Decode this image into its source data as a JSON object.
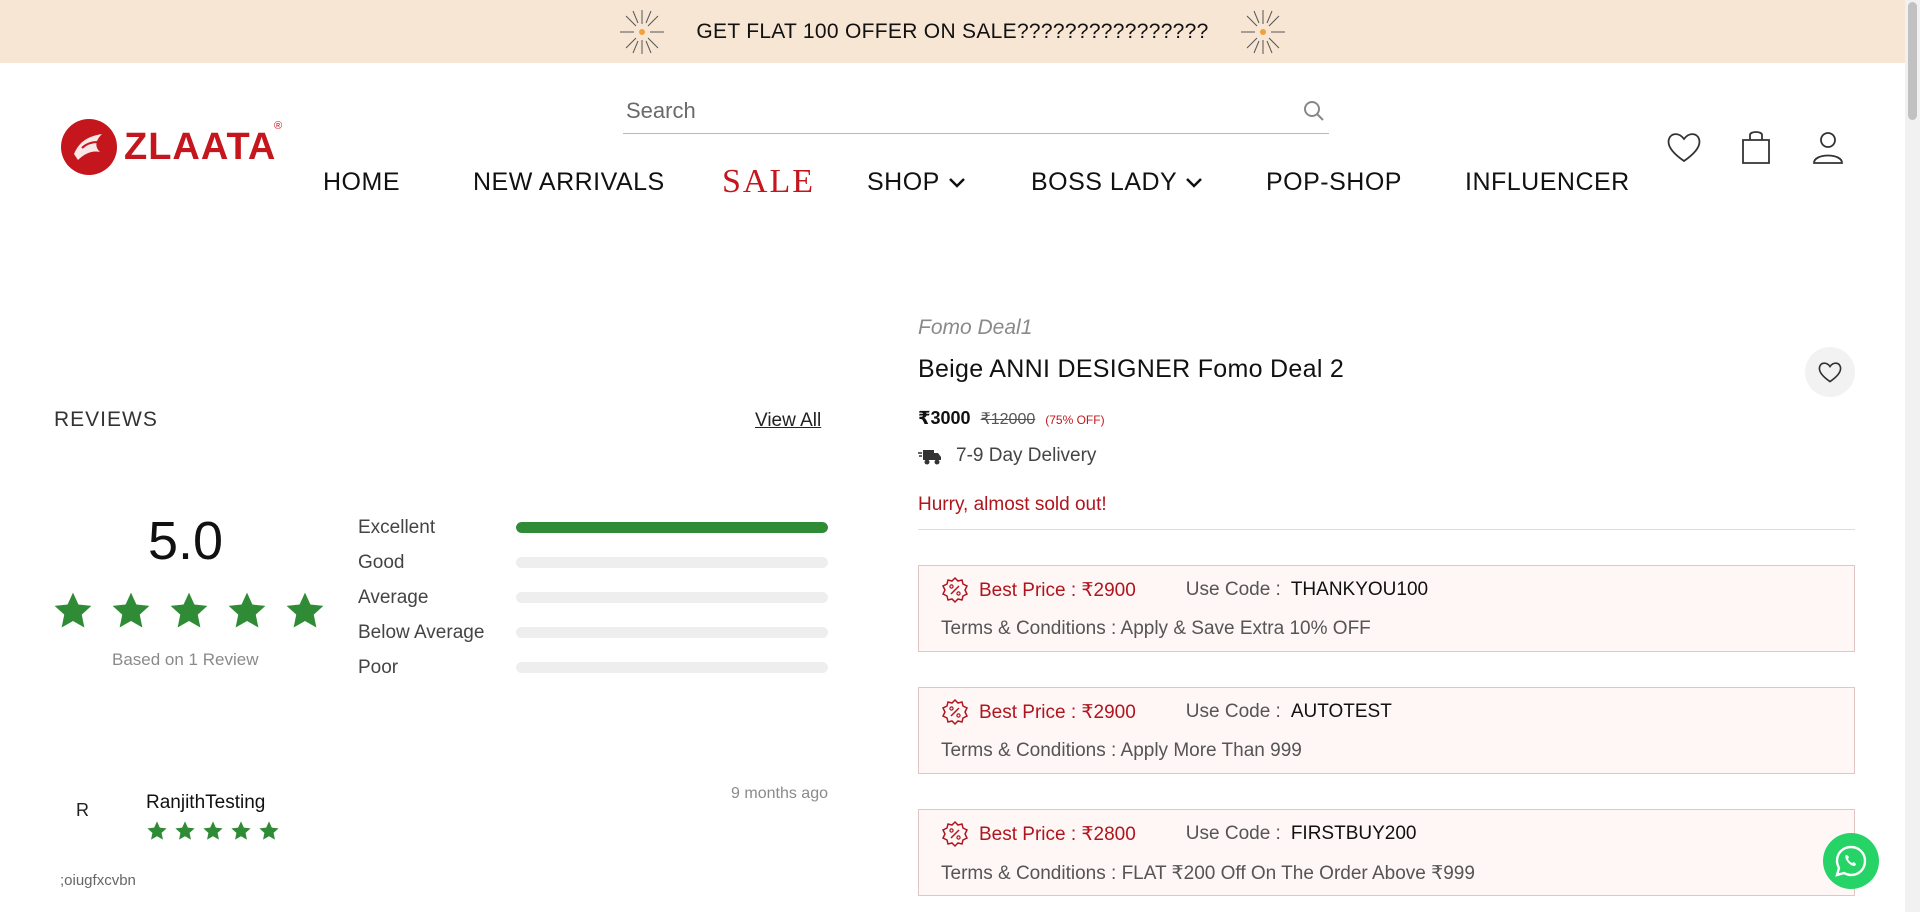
{
  "announcement": {
    "text": "GET FLAT 100 OFFER ON SALE????????????????"
  },
  "brand_logo": {
    "text": "ZLAATA",
    "registered": "®"
  },
  "search": {
    "placeholder": "Search"
  },
  "nav": {
    "items": [
      {
        "label": "HOME"
      },
      {
        "label": "NEW ARRIVALS"
      },
      {
        "label": "SALE"
      },
      {
        "label": "SHOP"
      },
      {
        "label": "BOSS LADY"
      },
      {
        "label": "POP-SHOP"
      },
      {
        "label": "INFLUENCER"
      }
    ]
  },
  "header_icons": [
    "heart-icon",
    "shopping-bag-icon",
    "user-icon"
  ],
  "reviews": {
    "title": "REVIEWS",
    "view_all": "View All",
    "score": "5.0",
    "stars": 5,
    "based_on": "Based on 1 Review",
    "breakdown": [
      {
        "label": "Excellent",
        "fraction": 1.0
      },
      {
        "label": "Good",
        "fraction": 0
      },
      {
        "label": "Average",
        "fraction": 0
      },
      {
        "label": "Below Average",
        "fraction": 0
      },
      {
        "label": "Poor",
        "fraction": 0
      }
    ],
    "items": [
      {
        "initial": "R",
        "name": "RanjithTesting",
        "stars": 5,
        "time": "9 months ago",
        "text": ";oiugfxcvbn"
      }
    ]
  },
  "product": {
    "brand": "Fomo Deal1",
    "title": "Beige ANNI DESIGNER Fomo Deal 2",
    "price": "₹3000",
    "mrp": "₹12000",
    "discount": "(75% OFF)",
    "delivery": "7-9 Day Delivery",
    "stock_notice": "Hurry, almost sold out!"
  },
  "offers": [
    {
      "best_label": "Best Price : ₹2900",
      "use_label": "Use Code :",
      "code": "THANKYOU100",
      "terms": "Terms & Conditions : Apply & Save Extra 10% OFF"
    },
    {
      "best_label": "Best Price : ₹2900",
      "use_label": "Use Code :",
      "code": "AUTOTEST",
      "terms": "Terms & Conditions : Apply More Than 999"
    },
    {
      "best_label": "Best Price : ₹2800",
      "use_label": "Use Code :",
      "code": "FIRSTBUY200",
      "terms": "Terms & Conditions : FLAT ₹200 Off On The Order Above ₹999"
    }
  ],
  "colors": {
    "announcement_bg": "#f8e6d4",
    "brand_red": "#c4161c",
    "star_green": "#2f8b35",
    "offer_bg": "#fff6f6",
    "whatsapp_green": "#25d366"
  }
}
